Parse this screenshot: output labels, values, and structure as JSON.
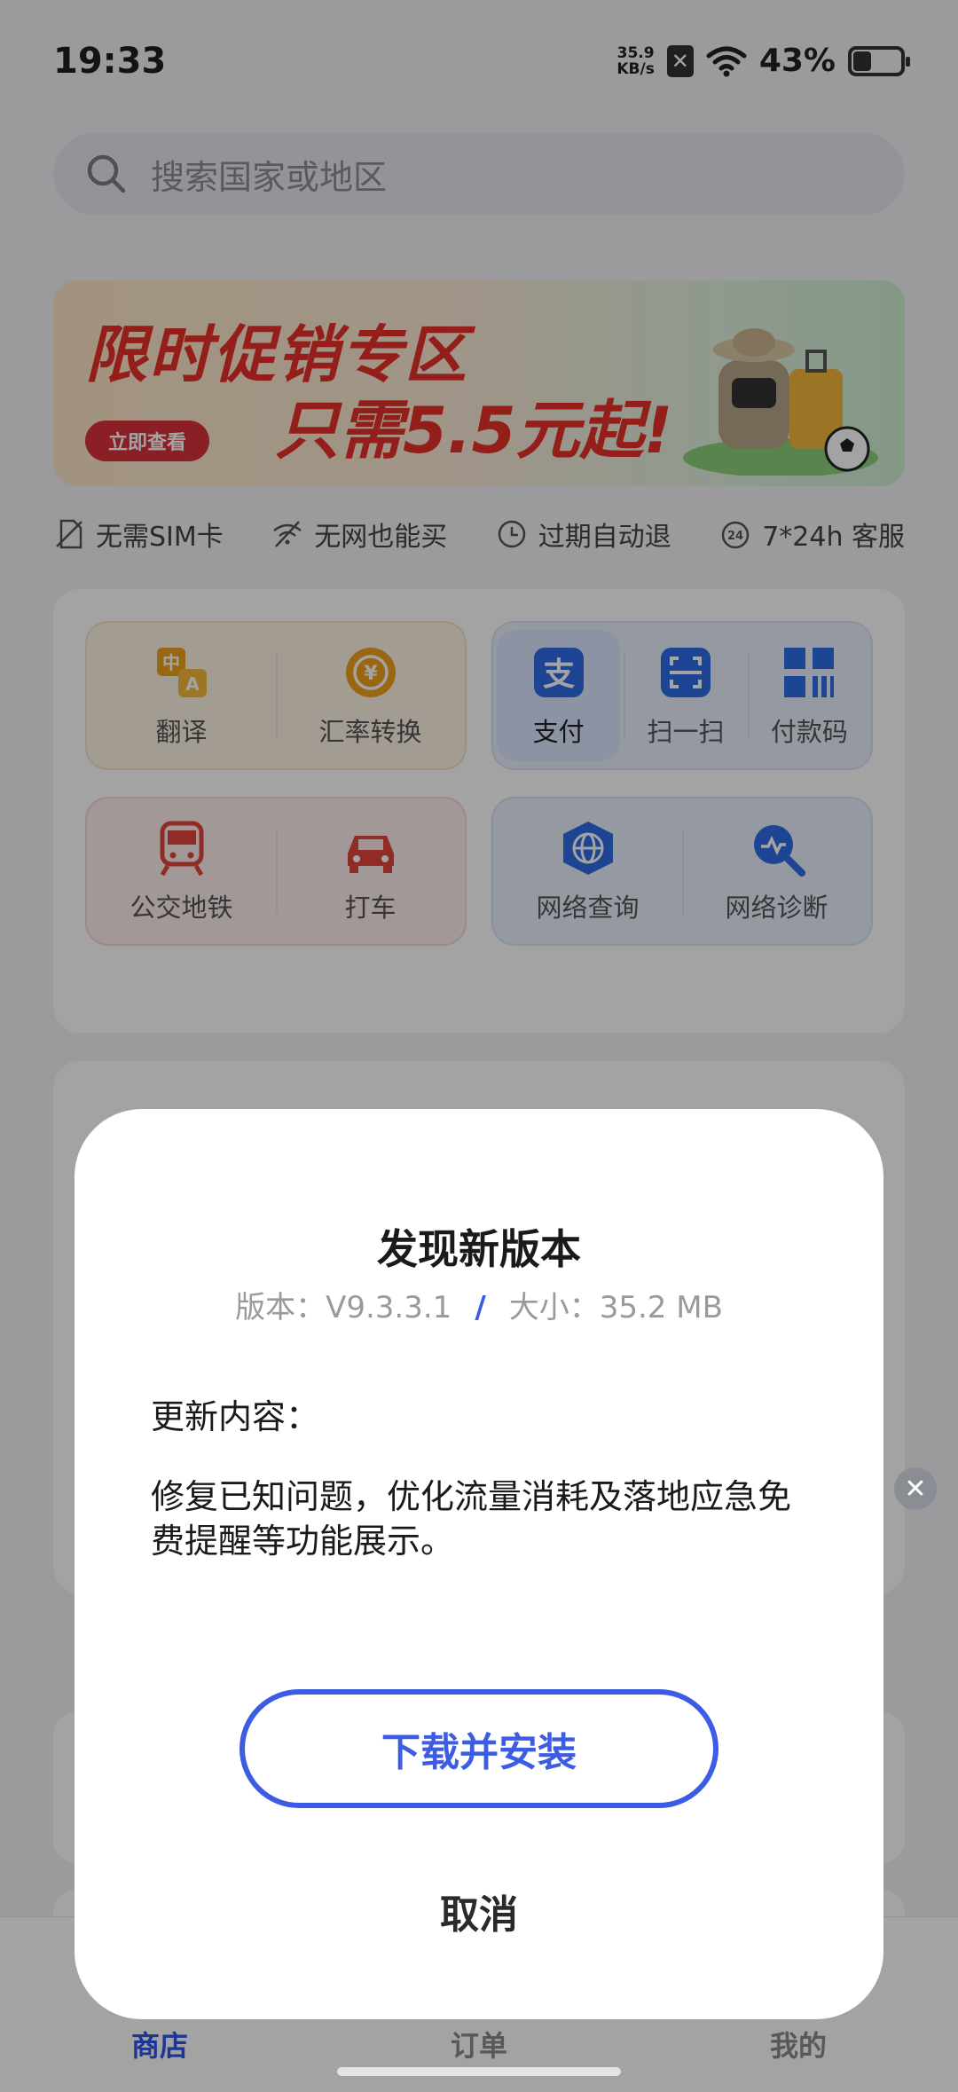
{
  "status_bar": {
    "time": "19:33",
    "net_speed_value": "35.9",
    "net_speed_unit": "KB/s",
    "battery_percent": "43%",
    "battery_level": 0.43
  },
  "search": {
    "placeholder": "搜索国家或地区"
  },
  "banner": {
    "line1": "限时促销专区",
    "line2": "只需5.5元起!",
    "button": "立即查看"
  },
  "features": [
    {
      "label": "无需SIM卡",
      "icon": "no-sim-icon"
    },
    {
      "label": "无网也能买",
      "icon": "no-wifi-icon"
    },
    {
      "label": "过期自动退",
      "icon": "clock-refund-icon"
    },
    {
      "label": "7*24h 客服",
      "icon": "24h-service-icon"
    }
  ],
  "tools": {
    "translate": "翻译",
    "exchange": "汇率转换",
    "pay": "支付",
    "scan": "扫一扫",
    "pay_code": "付款码",
    "transit": "公交地铁",
    "taxi": "打车",
    "network_query": "网络查询",
    "network_diag": "网络诊断"
  },
  "dialog": {
    "title": "发现新版本",
    "version_label": "版本：",
    "version": "V9.3.3.1",
    "separator": "/",
    "size_label": "大小：",
    "size": "35.2 MB",
    "content_label": "更新内容：",
    "content": "修复已知问题，优化流量消耗及落地应急免费提醒等功能展示。",
    "download_button": "下载并安装",
    "cancel_button": "取消"
  },
  "nav": {
    "shop": "商店",
    "orders": "订单",
    "mine": "我的"
  },
  "colors": {
    "accent": "#3c5ce4",
    "promo_red": "#e8312a"
  }
}
